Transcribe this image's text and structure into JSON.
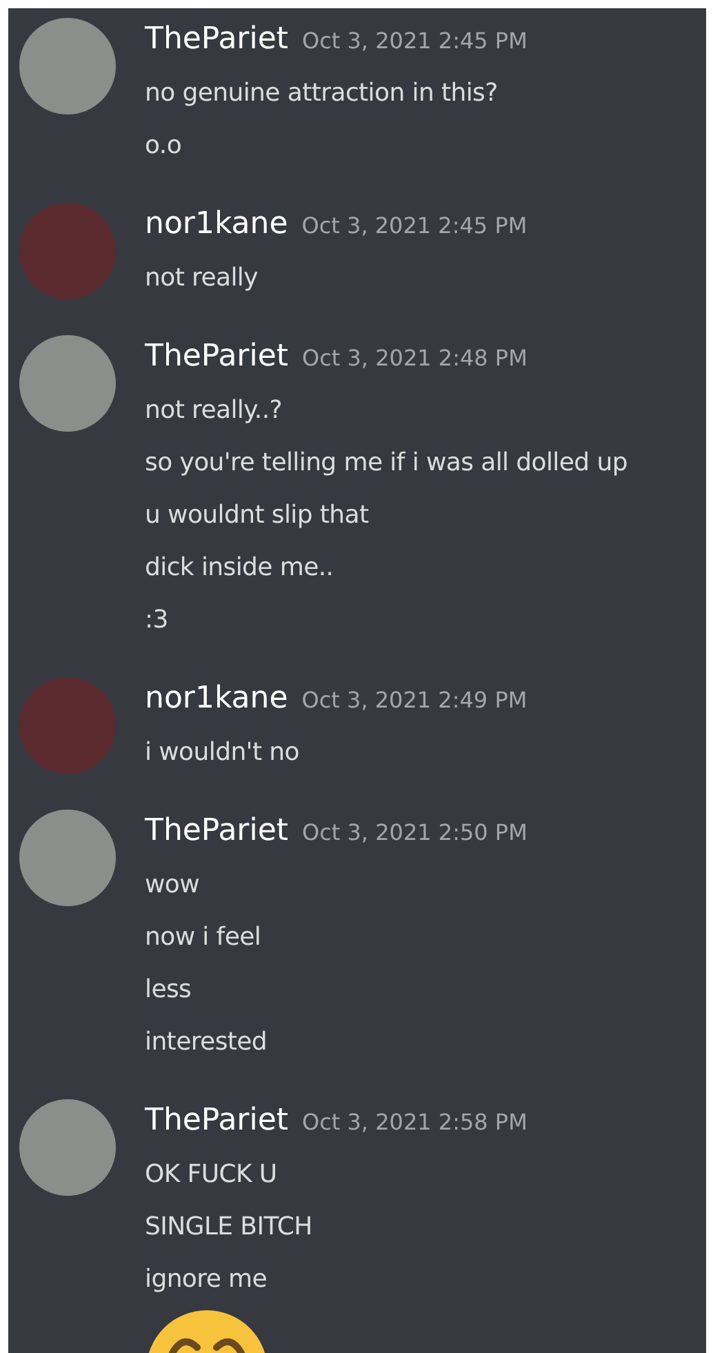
{
  "messages": [
    {
      "author": "ThePariet",
      "color": "#8a8f8c",
      "time": "Oct 3, 2021 2:45 PM",
      "lines": [
        {
          "kind": "text",
          "text": "no genuine attraction in this?"
        },
        {
          "kind": "text",
          "text": "o.o"
        }
      ]
    },
    {
      "author": "nor1kane",
      "color": "#5a2a2e",
      "time": "Oct 3, 2021 2:45 PM",
      "lines": [
        {
          "kind": "text",
          "text": "not really"
        }
      ]
    },
    {
      "author": "ThePariet",
      "color": "#8a8f8c",
      "time": "Oct 3, 2021 2:48 PM",
      "lines": [
        {
          "kind": "text",
          "text": "not really..?"
        },
        {
          "kind": "text",
          "text": "so you're telling me if i was all dolled up"
        },
        {
          "kind": "text",
          "text": "u wouldnt slip that"
        },
        {
          "kind": "text",
          "text": "dick inside me.."
        },
        {
          "kind": "text",
          "text": ":3"
        }
      ]
    },
    {
      "author": "nor1kane",
      "color": "#5a2a2e",
      "time": "Oct 3, 2021 2:49 PM",
      "lines": [
        {
          "kind": "text",
          "text": "i wouldn't no"
        }
      ]
    },
    {
      "author": "ThePariet",
      "color": "#8a8f8c",
      "time": "Oct 3, 2021 2:50 PM",
      "lines": [
        {
          "kind": "text",
          "text": "wow"
        },
        {
          "kind": "text",
          "text": "now i feel"
        },
        {
          "kind": "text",
          "text": "less"
        },
        {
          "kind": "text",
          "text": "interested"
        }
      ]
    },
    {
      "author": "ThePariet",
      "color": "#8a8f8c",
      "time": "Oct 3, 2021 2:58 PM",
      "lines": [
        {
          "kind": "text",
          "text": "OK FUCK U"
        },
        {
          "kind": "text",
          "text": "SINGLE BITCH"
        },
        {
          "kind": "text",
          "text": "ignore me"
        },
        {
          "kind": "emoji"
        }
      ]
    }
  ]
}
